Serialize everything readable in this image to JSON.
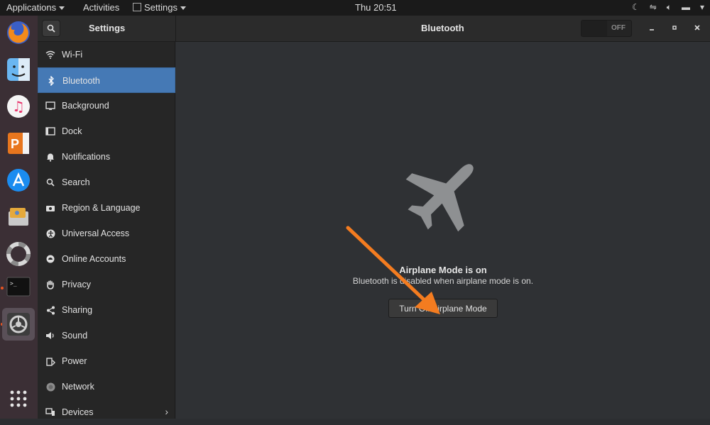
{
  "topbar": {
    "applications_label": "Applications",
    "activities_label": "Activities",
    "app_menu_label": "Settings",
    "clock": "Thu 20:51"
  },
  "header": {
    "sidebar_title": "Settings",
    "panel_title": "Bluetooth",
    "toggle_state": "OFF"
  },
  "sidebar": {
    "items": [
      {
        "label": "Wi-Fi",
        "icon": "wifi-icon"
      },
      {
        "label": "Bluetooth",
        "icon": "bluetooth-icon",
        "active": true
      },
      {
        "label": "Background",
        "icon": "background-icon"
      },
      {
        "label": "Dock",
        "icon": "dock-icon"
      },
      {
        "label": "Notifications",
        "icon": "bell-icon"
      },
      {
        "label": "Search",
        "icon": "search-icon"
      },
      {
        "label": "Region & Language",
        "icon": "camera-icon"
      },
      {
        "label": "Universal Access",
        "icon": "accessibility-icon"
      },
      {
        "label": "Online Accounts",
        "icon": "cloud-icon"
      },
      {
        "label": "Privacy",
        "icon": "hand-icon"
      },
      {
        "label": "Sharing",
        "icon": "share-icon"
      },
      {
        "label": "Sound",
        "icon": "speaker-icon"
      },
      {
        "label": "Power",
        "icon": "power-icon"
      },
      {
        "label": "Network",
        "icon": "network-icon"
      },
      {
        "label": "Devices",
        "icon": "devices-icon"
      }
    ]
  },
  "main": {
    "message_title": "Airplane Mode is on",
    "message_subtitle": "Bluetooth is disabled when airplane mode is on.",
    "turn_off_button": "Turn Off Airplane Mode"
  },
  "colors": {
    "accent": "#4579b5",
    "arrow": "#f47c20",
    "ubuntu_orange": "#e95420"
  }
}
